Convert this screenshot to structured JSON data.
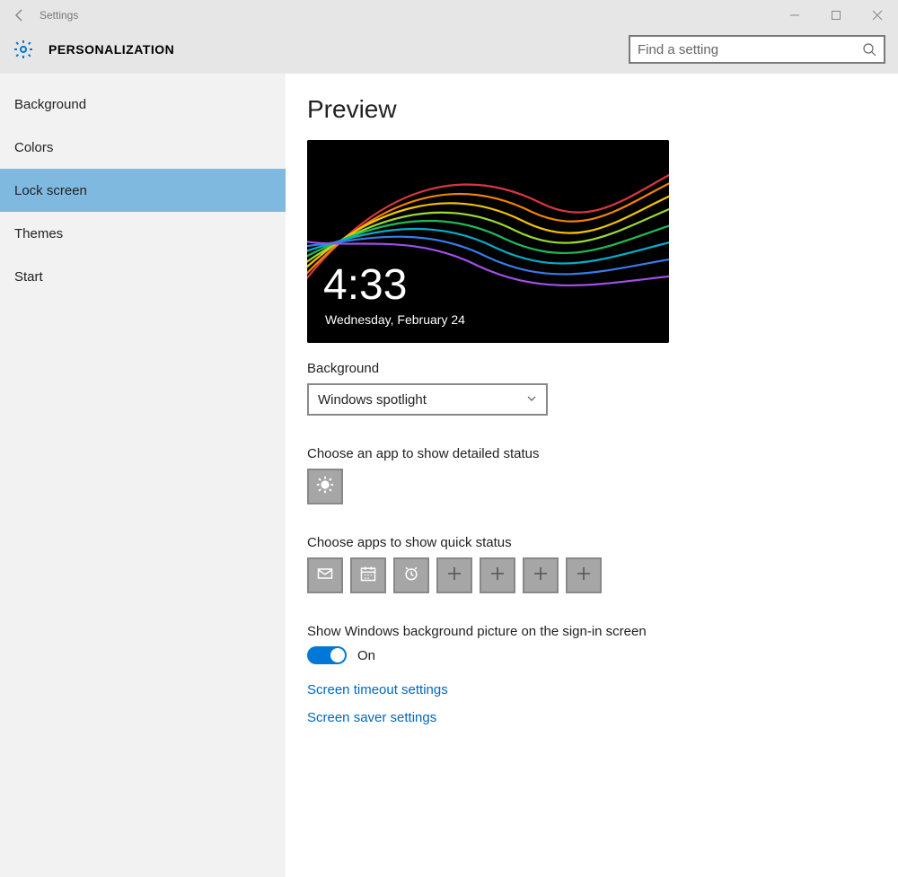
{
  "window": {
    "title": "Settings"
  },
  "header": {
    "section": "PERSONALIZATION",
    "search_placeholder": "Find a setting"
  },
  "sidebar": {
    "items": [
      {
        "label": "Background",
        "selected": false
      },
      {
        "label": "Colors",
        "selected": false
      },
      {
        "label": "Lock screen",
        "selected": true
      },
      {
        "label": "Themes",
        "selected": false
      },
      {
        "label": "Start",
        "selected": false
      }
    ]
  },
  "content": {
    "preview_heading": "Preview",
    "lock_screen_time": "4:33",
    "lock_screen_date": "Wednesday, February 24",
    "background_label": "Background",
    "background_selected": "Windows spotlight",
    "detailed_status_label": "Choose an app to show detailed status",
    "detailed_status_app": "weather",
    "quick_status_label": "Choose apps to show quick status",
    "quick_status_apps": [
      "mail",
      "calendar",
      "alarms",
      "add",
      "add",
      "add",
      "add"
    ],
    "signin_bg_label": "Show Windows background picture on the sign-in screen",
    "signin_bg_toggle": "On",
    "links": {
      "timeout": "Screen timeout settings",
      "saver": "Screen saver settings"
    }
  }
}
